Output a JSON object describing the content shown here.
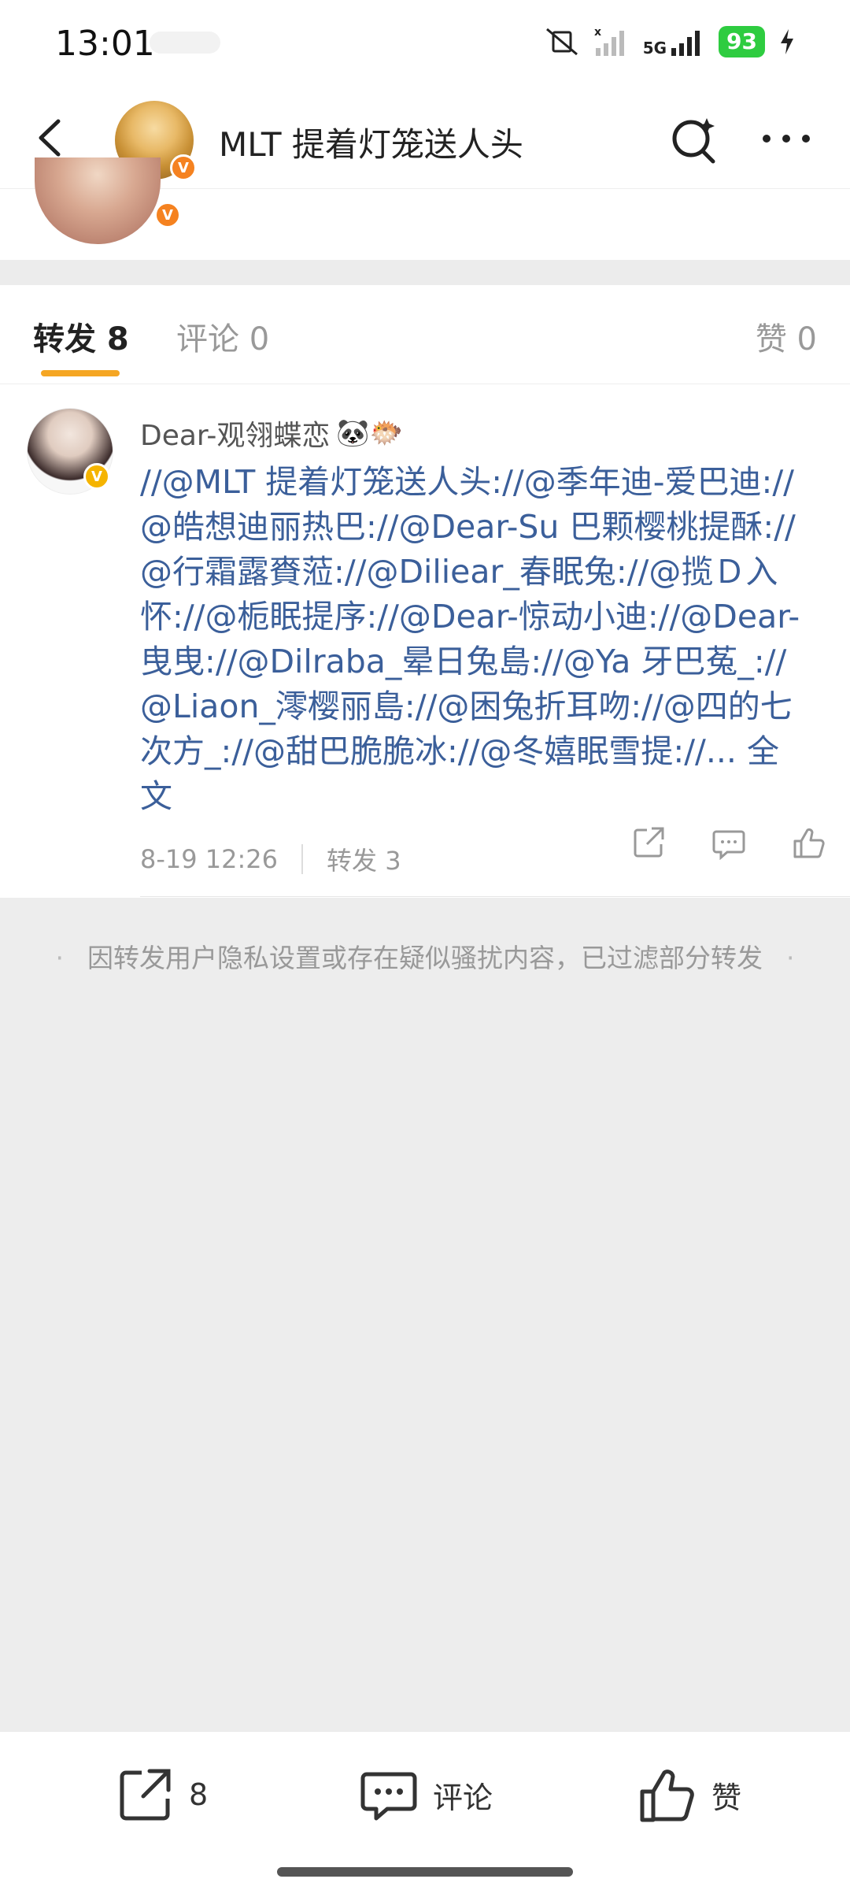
{
  "status_bar": {
    "time": "13:01",
    "network": "5G",
    "battery": "93"
  },
  "header": {
    "title": "MLT 提着灯笼送人头"
  },
  "tabs": {
    "repost": "转发 8",
    "comment": "评论 0",
    "like": "赞 0"
  },
  "repost_item": {
    "username": "Dear-观翎蝶恋",
    "username_emojis": "🐼🐡",
    "text": "//@MLT 提着灯笼送人头://@季年迪-爱巴迪://@皓想迪丽热巴://@Dear-Su 巴颗樱桃提酥://@行霜露賚蒞://@Diliear_春眠兔://@揽Ｄ入怀://@栀眠提序://@Dear-惊动小迪://@Dear-曳曳://@Dilraba_晕日兔島://@Ya 牙巴菟_://@Liaon_澪樱丽島://@困兔折耳吻://@四的七次方_://@甜巴脆脆冰://@冬嬉眠雪提://...",
    "full_text_link": "全文",
    "timestamp": "8-19 12:26",
    "repost_count": "转发 3"
  },
  "notice": "因转发用户隐私设置或存在疑似骚扰内容，已过滤部分转发",
  "bottom_bar": {
    "repost_count": "8",
    "comment_label": "评论",
    "like_label": "赞"
  },
  "colors": {
    "accent_underline": "#f5a623",
    "link_blue": "#3b5f9a",
    "badge_orange": "#f58220",
    "battery_green": "#2ecc40"
  }
}
